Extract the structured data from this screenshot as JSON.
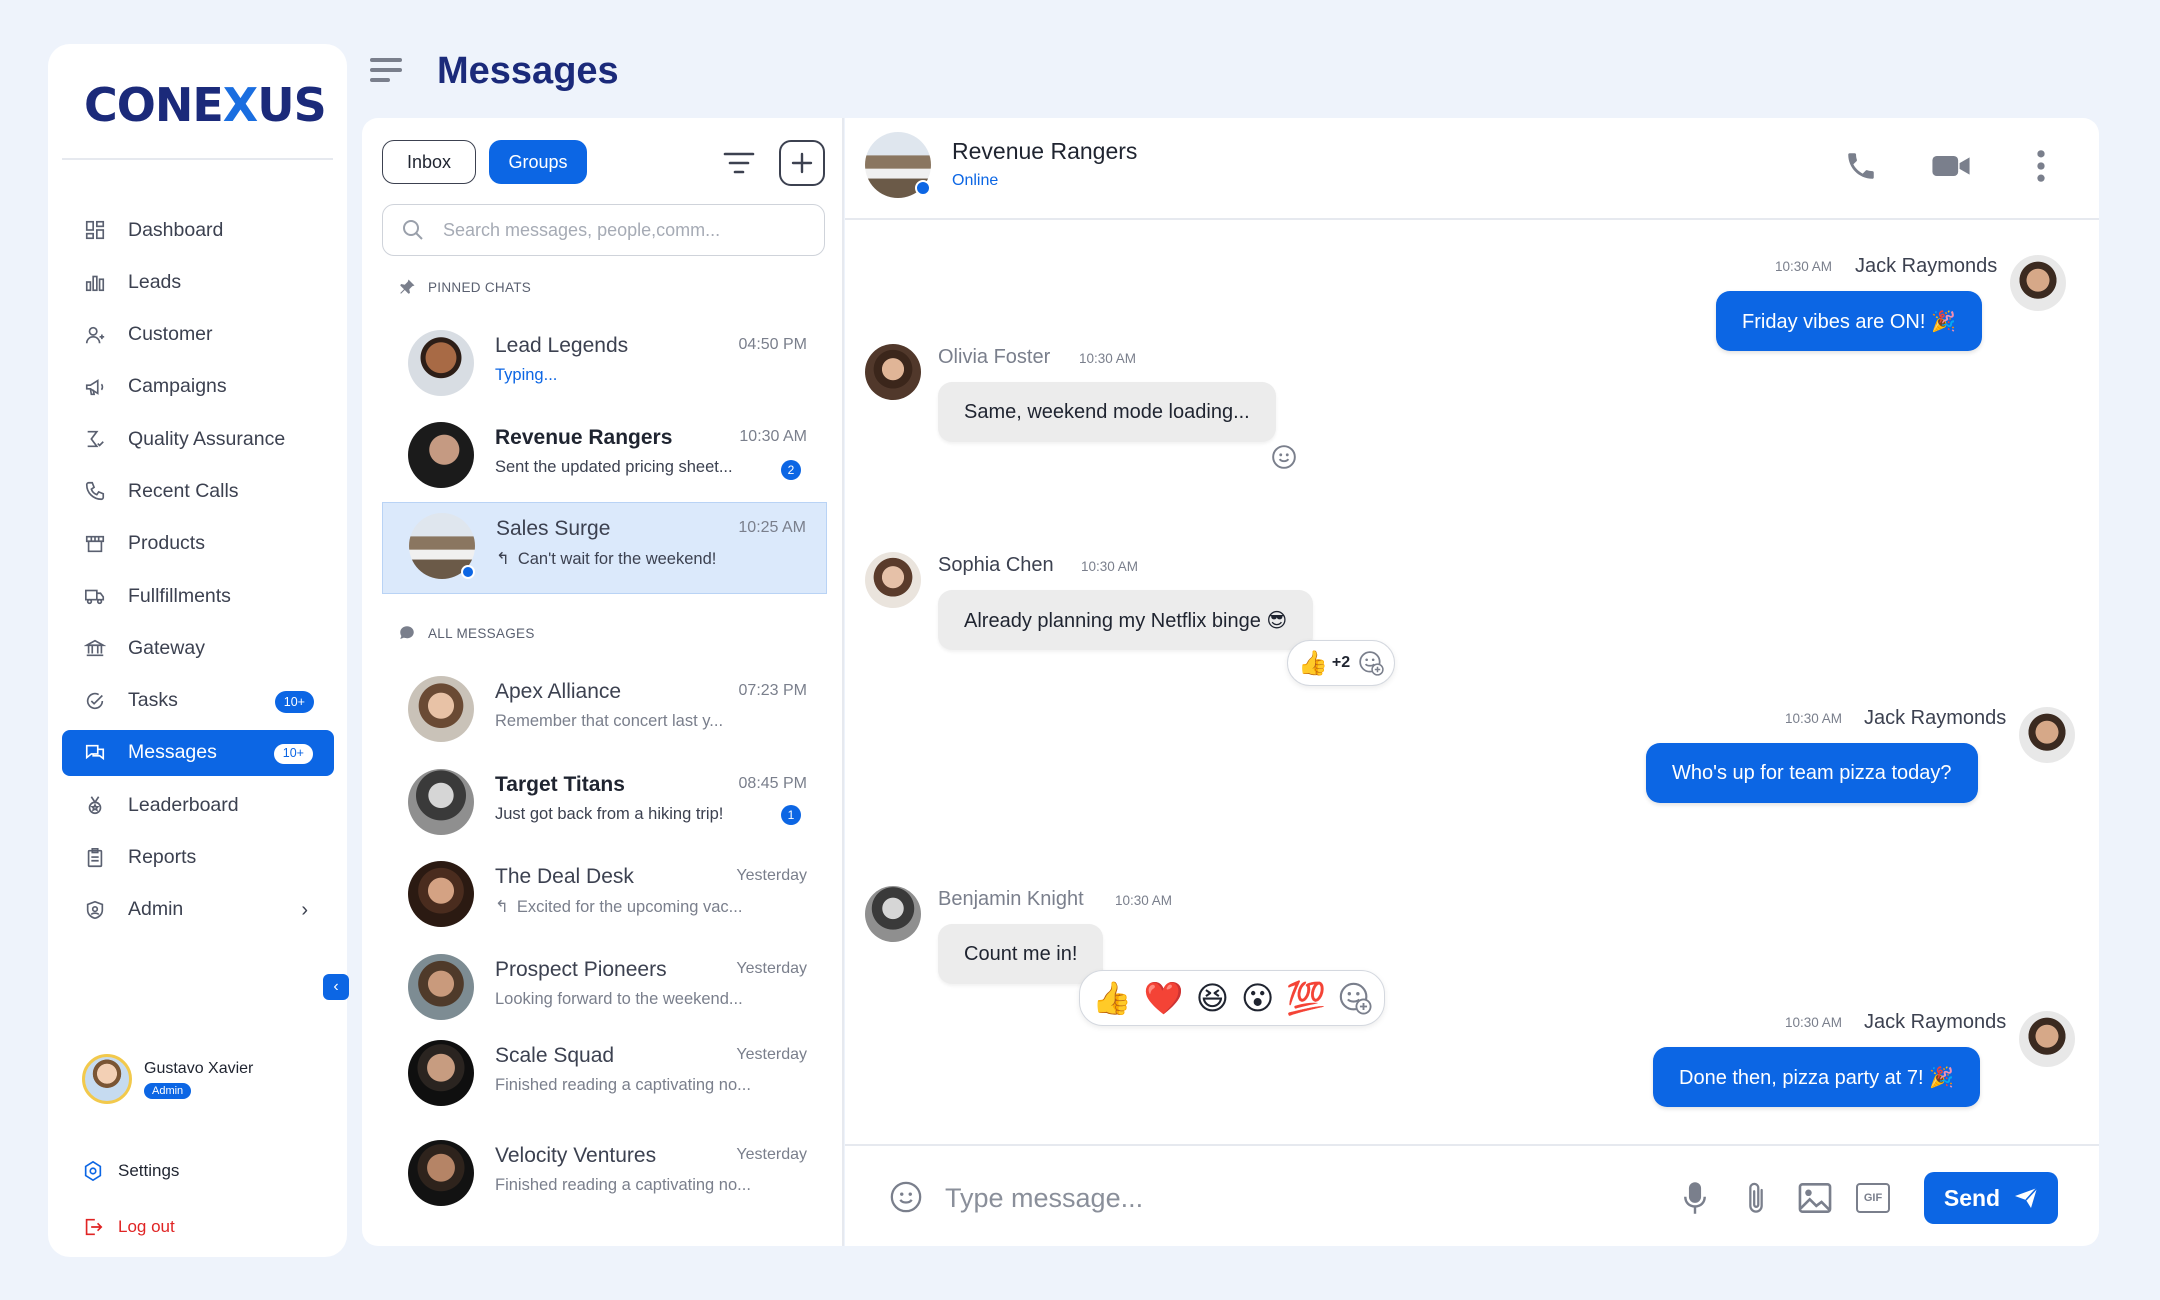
{
  "brand": {
    "logo_pre": "CONE",
    "logo_x": "X",
    "logo_post": "US"
  },
  "page_title": "Messages",
  "sidebar": {
    "items": [
      {
        "label": "Dashboard",
        "icon": "dashboard-icon"
      },
      {
        "label": "Leads",
        "icon": "chart-icon"
      },
      {
        "label": "Customer",
        "icon": "customer-icon"
      },
      {
        "label": "Campaigns",
        "icon": "megaphone-icon"
      },
      {
        "label": "Quality Assurance",
        "icon": "quality-icon"
      },
      {
        "label": "Recent Calls",
        "icon": "phone-icon"
      },
      {
        "label": "Products",
        "icon": "store-icon"
      },
      {
        "label": "Fullfillments",
        "icon": "truck-icon"
      },
      {
        "label": "Gateway",
        "icon": "bank-icon"
      },
      {
        "label": "Tasks",
        "icon": "tasks-icon",
        "badge": "10+"
      },
      {
        "label": "Messages",
        "icon": "messages-icon",
        "badge": "10+",
        "active": true
      },
      {
        "label": "Leaderboard",
        "icon": "medal-icon"
      },
      {
        "label": "Reports",
        "icon": "clipboard-icon"
      },
      {
        "label": "Admin",
        "icon": "shield-icon",
        "chevron": "›"
      }
    ],
    "collapse_label": "‹",
    "user": {
      "name": "Gustavo Xavier",
      "role": "Admin"
    },
    "settings_label": "Settings",
    "logout_label": "Log out"
  },
  "conversations": {
    "tabs": {
      "inbox": "Inbox",
      "groups": "Groups"
    },
    "search_placeholder": "Search messages, people,comm...",
    "pinned_label": "PINNED CHATS",
    "all_label": "ALL MESSAGES",
    "pinned": [
      {
        "name": "Lead Legends",
        "time": "04:50 PM",
        "preview": "Typing...",
        "typing": true
      },
      {
        "name": "Revenue Rangers",
        "time": "10:30 AM",
        "preview": "Sent the updated pricing sheet...",
        "unread": "2",
        "bold": true
      },
      {
        "name": "Sales Surge",
        "time": "10:25 AM",
        "preview": "Can't wait for the weekend!",
        "reply": true,
        "selected": true,
        "online": true
      }
    ],
    "all": [
      {
        "name": "Apex Alliance",
        "time": "07:23 PM",
        "preview": "Remember that concert last y..."
      },
      {
        "name": "Target Titans",
        "time": "08:45 PM",
        "preview": "Just got back from a hiking trip!",
        "unread": "1",
        "bold": true
      },
      {
        "name": "The Deal Desk",
        "time": "Yesterday",
        "preview": "Excited for the upcoming vac...",
        "reply": true
      },
      {
        "name": "Prospect Pioneers",
        "time": "Yesterday",
        "preview": "Looking forward to the weekend..."
      },
      {
        "name": "Scale Squad",
        "time": "Yesterday",
        "preview": "Finished reading a captivating no..."
      },
      {
        "name": "Velocity Ventures",
        "time": "Yesterday",
        "preview": "Finished reading a captivating no..."
      }
    ]
  },
  "chat": {
    "title": "Revenue Rangers",
    "status": "Online",
    "messages": [
      {
        "sender": "Jack Raymonds",
        "time": "10:30 AM",
        "text": "Friday vibes are ON! 🎉",
        "outgoing": true
      },
      {
        "sender": "Olivia Foster",
        "time": "10:30 AM",
        "text": "Same, weekend mode loading..."
      },
      {
        "sender": "Sophia Chen",
        "time": "10:30 AM",
        "text": "Already planning my Netflix binge 😎",
        "reaction": "👍",
        "reaction_count": "+2"
      },
      {
        "sender": "Jack Raymonds",
        "time": "10:30 AM",
        "text": "Who's up for team pizza today?",
        "outgoing": true
      },
      {
        "sender": "Benjamin Knight",
        "time": "10:30 AM",
        "text": "Count me in!",
        "picker": [
          "👍",
          "❤️",
          "😆",
          "😮",
          "💯"
        ]
      },
      {
        "sender": "Jack Raymonds",
        "time": "10:30 AM",
        "text": "Done then, pizza party at 7! 🎉",
        "outgoing": true
      }
    ],
    "composer_placeholder": "Type message...",
    "send_label": "Send",
    "gif_label": "GIF"
  },
  "colors": {
    "accent": "#0c66e4",
    "brand": "#1b2a7a",
    "danger": "#e02424"
  }
}
